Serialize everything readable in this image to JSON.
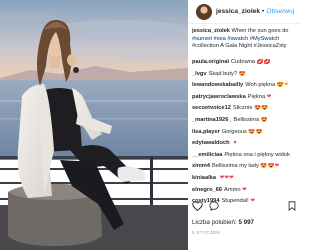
{
  "photo": {
    "alt_icon": "photo"
  },
  "header": {
    "username": "jessica_ziolek",
    "separator": "•",
    "follow_label": "Obserwuj"
  },
  "caption": {
    "username": "jessica_ziolek",
    "line1": "When the sun goes do",
    "line2": "#sunset #sea #swatch #MySwatch",
    "line3": "#collection A Gala Night #JessicaZsty"
  },
  "comments": [
    {
      "user": "paula.original",
      "text": "Cudowna",
      "emoji": "💋💋"
    },
    {
      "user": "_lvgv",
      "text": "Skąd buty?",
      "emoji": "😍"
    },
    {
      "user": "lewandowskabailly",
      "text": "Woh piękna",
      "emoji": "😍❤"
    },
    {
      "user": "patrycjawroclawska",
      "text": "Piękna",
      "emoji": "❤"
    },
    {
      "user": "secoetvoice12",
      "text": "Ślicznie",
      "emoji": "😍😍"
    },
    {
      "user": "_martina1926_",
      "text": "Bellissima",
      "emoji": "😍"
    },
    {
      "user": "lisa.player",
      "text": "Gorgeous",
      "emoji": "😍😍"
    },
    {
      "user": "edytawaldoch",
      "text": "",
      "emoji": "♥"
    },
    {
      "user": "__emiliciaa",
      "text": "Piękna ona i piękny widok",
      "emoji": ""
    },
    {
      "user": "ximm4",
      "text": "Bellissima my lady",
      "emoji": "😍😍❤"
    },
    {
      "user": "kiniaalka",
      "text": "",
      "emoji": "❤❤❤"
    },
    {
      "user": "elnegro_66",
      "text": "Ammo",
      "emoji": "❤"
    },
    {
      "user": "costy1994",
      "text": "Stupendal!",
      "emoji": "❤"
    }
  ],
  "likes": {
    "label": "Liczba polubień:",
    "count": "5 997"
  },
  "date": "5 STYCZEŃ",
  "colors": {
    "link": "#003569",
    "follow": "#3897f0",
    "heart": "#ed4956",
    "sky_top": "#9fb4c9",
    "sky_sunset": "#f2c7a0",
    "sea": "#7f97b2"
  },
  "icons": [
    "heart-icon",
    "comment-icon",
    "bookmark-icon"
  ]
}
